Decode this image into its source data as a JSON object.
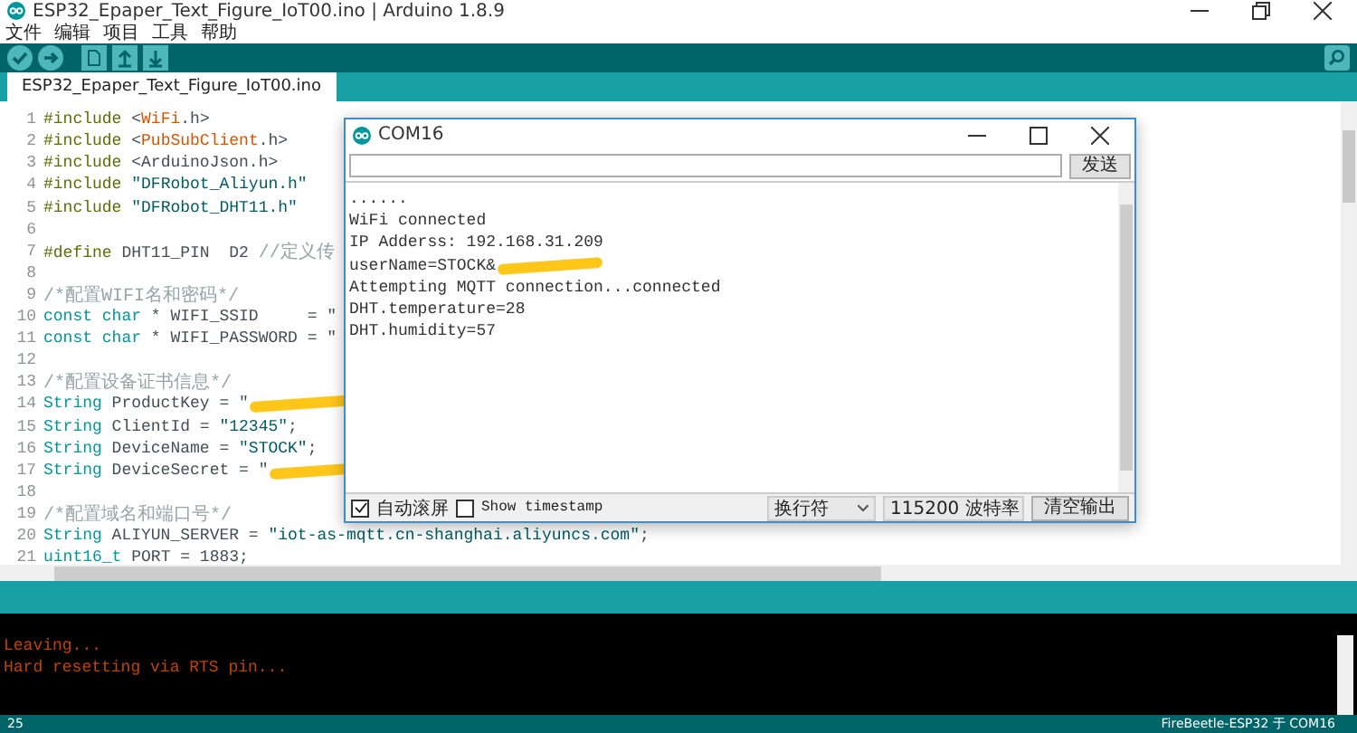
{
  "window": {
    "title": "ESP32_Epaper_Text_Figure_IoT00.ino | Arduino 1.8.9"
  },
  "menu": [
    "文件",
    "编辑",
    "项目",
    "工具",
    "帮助"
  ],
  "tabs": [
    {
      "label": "ESP32_Epaper_Text_Figure_IoT00.ino",
      "selected": true
    }
  ],
  "editor": {
    "lines": [
      {
        "number": "1",
        "tokens": [
          {
            "text": "#include",
            "kind": "directive"
          },
          {
            "text": " <",
            "kind": "plain"
          },
          {
            "text": "WiFi",
            "kind": "lib"
          },
          {
            "text": ".h>",
            "kind": "plain"
          }
        ]
      },
      {
        "number": "2",
        "tokens": [
          {
            "text": "#include",
            "kind": "directive"
          },
          {
            "text": " <",
            "kind": "plain"
          },
          {
            "text": "PubSubClient",
            "kind": "lib"
          },
          {
            "text": ".h>",
            "kind": "plain"
          }
        ]
      },
      {
        "number": "3",
        "tokens": [
          {
            "text": "#include",
            "kind": "directive"
          },
          {
            "text": " <ArduinoJson.h>",
            "kind": "plain"
          }
        ]
      },
      {
        "number": "4",
        "tokens": [
          {
            "text": "#include",
            "kind": "directive"
          },
          {
            "text": " \"DFRobot_Aliyun.h\"",
            "kind": "string"
          }
        ]
      },
      {
        "number": "5",
        "tokens": [
          {
            "text": "#include",
            "kind": "directive"
          },
          {
            "text": " \"DFRobot_DHT11.h\"",
            "kind": "string"
          }
        ]
      },
      {
        "number": "6"
      },
      {
        "number": "7",
        "tokens": [
          {
            "text": "#define",
            "kind": "directive"
          },
          {
            "text": " DHT11_PIN  D2 ",
            "kind": "plain"
          },
          {
            "text": "//定义传",
            "kind": "comment"
          }
        ]
      },
      {
        "number": "8"
      },
      {
        "number": "9",
        "tokens": [
          {
            "text": "/*配置WIFI名和密码*/",
            "kind": "comment"
          }
        ]
      },
      {
        "number": "10",
        "tokens": [
          {
            "text": "const char",
            "kind": "type"
          },
          {
            "text": " * WIFI_SSID     = \"",
            "kind": "plain"
          }
        ]
      },
      {
        "number": "11",
        "tokens": [
          {
            "text": "const char",
            "kind": "type"
          },
          {
            "text": " * WIFI_PASSWORD = \"",
            "kind": "plain"
          }
        ]
      },
      {
        "number": "12"
      },
      {
        "number": "13",
        "tokens": [
          {
            "text": "/*配置设备证书信息*/",
            "kind": "comment"
          }
        ]
      },
      {
        "number": "14",
        "tokens": [
          {
            "text": "String",
            "kind": "type"
          },
          {
            "text": " ProductKey = \"",
            "kind": "plain"
          }
        ],
        "redacted": true
      },
      {
        "number": "15",
        "tokens": [
          {
            "text": "String",
            "kind": "type"
          },
          {
            "text": " ClientId = ",
            "kind": "plain"
          },
          {
            "text": "\"12345\"",
            "kind": "string"
          },
          {
            "text": ";",
            "kind": "plain"
          }
        ]
      },
      {
        "number": "16",
        "tokens": [
          {
            "text": "String",
            "kind": "type"
          },
          {
            "text": " DeviceName = ",
            "kind": "plain"
          },
          {
            "text": "\"STOCK\"",
            "kind": "string"
          },
          {
            "text": ";",
            "kind": "plain"
          }
        ]
      },
      {
        "number": "17",
        "tokens": [
          {
            "text": "String",
            "kind": "type"
          },
          {
            "text": " DeviceSecret = \"",
            "kind": "plain"
          }
        ],
        "redacted": true
      },
      {
        "number": "18"
      },
      {
        "number": "19",
        "tokens": [
          {
            "text": "/*配置域名和端口号*/",
            "kind": "comment"
          }
        ]
      },
      {
        "number": "20",
        "tokens": [
          {
            "text": "String",
            "kind": "type"
          },
          {
            "text": " ALIYUN_SERVER = ",
            "kind": "plain"
          },
          {
            "text": "\"iot-as-mqtt.cn-shanghai.aliyuncs.com\"",
            "kind": "string"
          },
          {
            "text": ";",
            "kind": "plain"
          }
        ]
      },
      {
        "number": "21",
        "tokens": [
          {
            "text": "uint16_t",
            "kind": "type"
          },
          {
            "text": " PORT = 1883;",
            "kind": "plain"
          }
        ]
      }
    ]
  },
  "console": {
    "lines": [
      "Leaving...",
      "Hard resetting via RTS pin..."
    ]
  },
  "status_bar": {
    "line": "25",
    "board": "FireBeetle-ESP32 于 COM16"
  },
  "serial_monitor": {
    "title": "COM16",
    "send_button": "发送",
    "output": [
      {
        "text": "......"
      },
      {
        "text": "WiFi connected"
      },
      {
        "text": "IP Adderss: 192.168.31.209"
      },
      {
        "text": "userName=STOCK&",
        "redacted": true
      },
      {
        "text": "Attempting MQTT connection...connected"
      },
      {
        "text": "DHT.temperature=28"
      },
      {
        "text": "DHT.humidity=57"
      }
    ],
    "autoscroll": {
      "label": "自动滚屏",
      "checked": true
    },
    "timestamp": {
      "label": "Show timestamp",
      "checked": false
    },
    "line_ending": "换行符",
    "baud": "115200 波特率",
    "clear_button": "清空输出"
  }
}
